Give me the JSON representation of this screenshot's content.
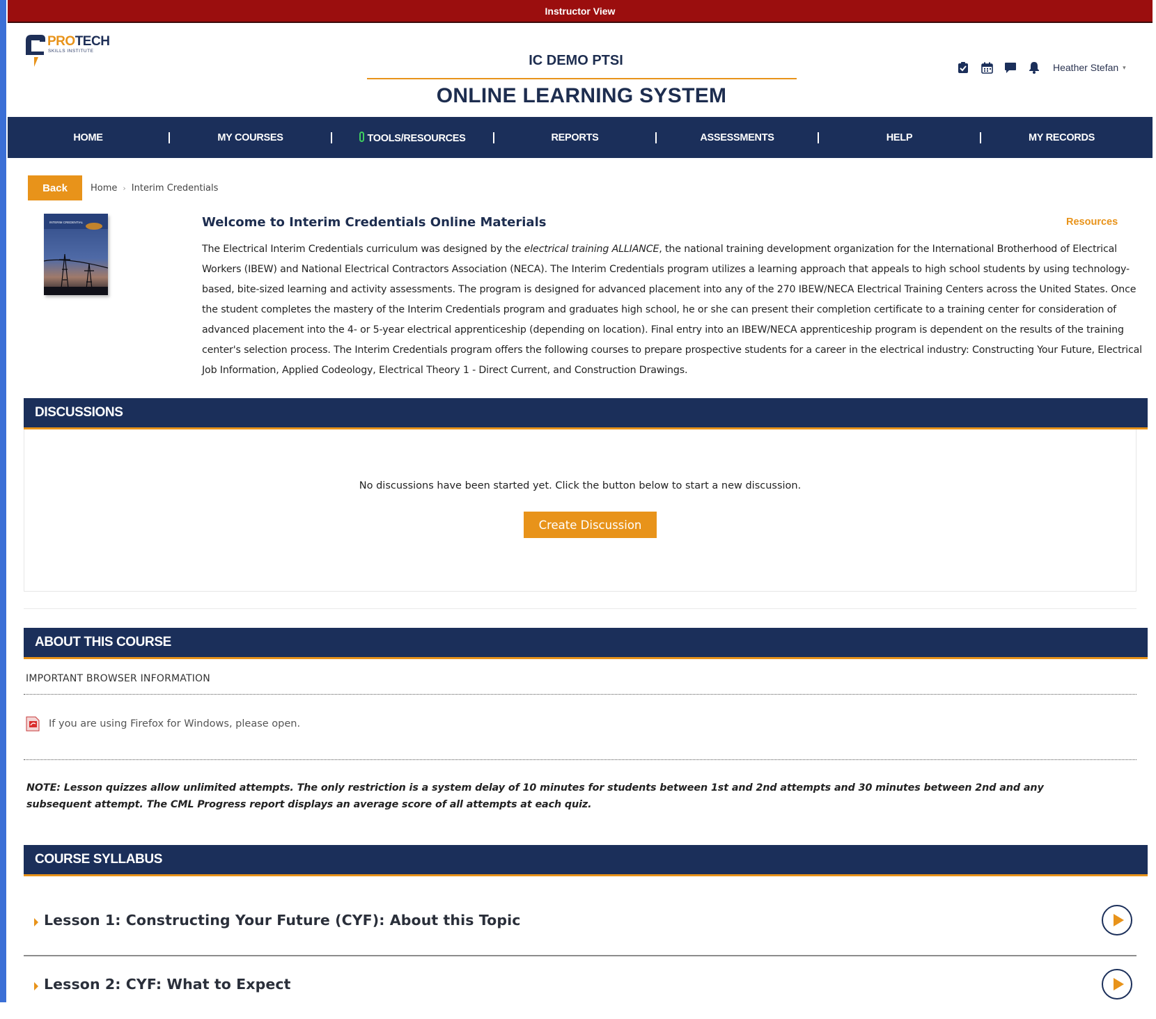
{
  "banner": {
    "text": "Instructor View"
  },
  "logo": {
    "main_pre": "PRO",
    "main_post": "TECH",
    "sub": "SKILLS INSTITUTE"
  },
  "header": {
    "org": "IC DEMO PTSI",
    "system": "ONLINE LEARNING SYSTEM",
    "user_name": "Heather Stefan",
    "icons": [
      "clipboard-check-icon",
      "calendar-icon",
      "chat-icon",
      "bell-icon"
    ]
  },
  "nav": {
    "items": [
      "HOME",
      "MY COURSES",
      "TOOLS/RESOURCES",
      "REPORTS",
      "ASSESSMENTS",
      "HELP",
      "MY RECORDS"
    ],
    "tools_badge": "0"
  },
  "breadcrumb": {
    "back": "Back",
    "home": "Home",
    "current": "Interim Credentials"
  },
  "course": {
    "welcome_title": "Welcome to Interim Credentials Online Materials",
    "resources_label": "Resources",
    "desc_pre": "The Electrical Interim Credentials curriculum was designed by the ",
    "desc_em": "electrical training ALLIANCE",
    "desc_post": ", the national training development organization for the International Brotherhood of Electrical Workers (IBEW) and National Electrical Contractors Association (NECA). The Interim Credentials program utilizes a learning approach that appeals to high school students by using technology-based, bite-sized learning and activity assessments. The program is designed for advanced placement into any of the 270 IBEW/NECA Electrical Training Centers across the United States. Once the student completes the mastery of the Interim Credentials program and graduates high school, he or she can present their completion certificate to a training center for consideration of advanced placement into the 4- or 5-year electrical apprenticeship (depending on location). Final entry into an IBEW/NECA apprenticeship program is dependent on the results of the training center's selection process. The Interim Credentials program offers the following courses to prepare prospective students for a career in the electrical industry: Constructing Your Future, Electrical Job Information, Applied Codeology, Electrical Theory 1 - Direct Current, and Construction Drawings.",
    "cover_label": "INTERIM CREDENTIAL"
  },
  "discussions": {
    "header": "DISCUSSIONS",
    "empty_text": "No discussions have been started yet. Click the button below to start a new discussion.",
    "create_label": "Create Discussion"
  },
  "about": {
    "header": "ABOUT THIS COURSE",
    "browser_info": "IMPORTANT BROWSER INFORMATION",
    "firefox_note": "If you are using Firefox for Windows, please open.",
    "note": "NOTE: Lesson quizzes allow unlimited attempts. The only restriction is a system delay of 10 minutes for students between 1st and 2nd attempts and 30 minutes between 2nd and any subsequent attempt. The CML Progress report displays an average score of all attempts at each quiz."
  },
  "syllabus": {
    "header": "COURSE SYLLABUS",
    "lessons": [
      "Lesson 1: Constructing Your Future (CYF): About this Topic",
      "Lesson 2: CYF: What to Expect"
    ]
  },
  "colors": {
    "banner": "#9b0e0e",
    "navy": "#1b2f5a",
    "accent": "#e8931a"
  }
}
